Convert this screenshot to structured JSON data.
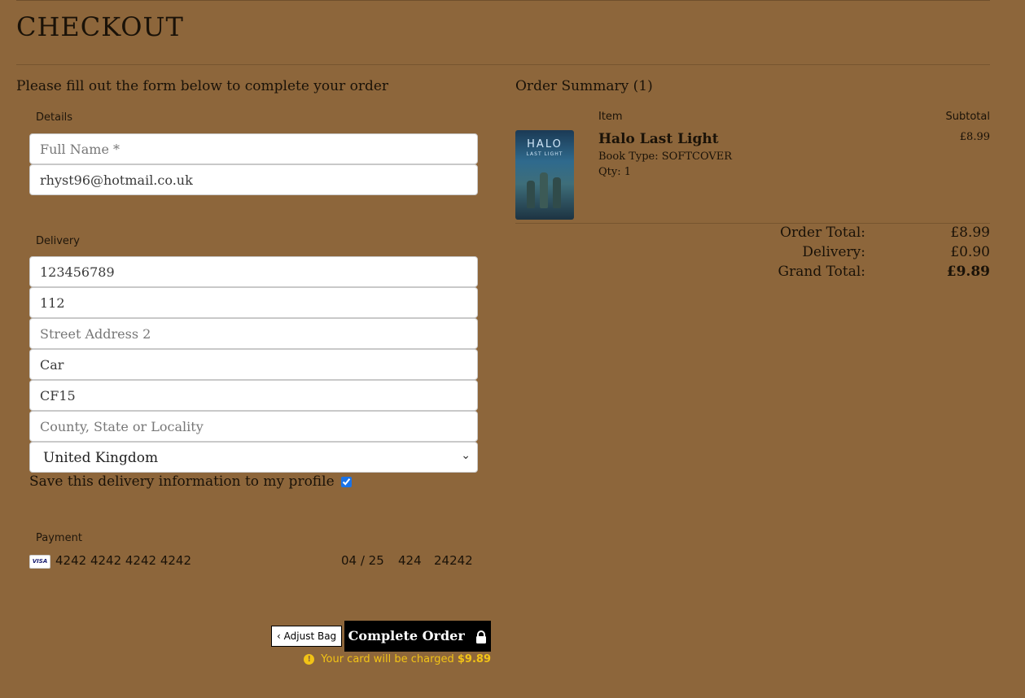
{
  "page": {
    "title": "CHECKOUT",
    "intro": "Please fill out the form below to complete your order"
  },
  "details": {
    "legend": "Details",
    "full_name_placeholder": "Full Name *",
    "email_value": "rhyst96@hotmail.co.uk"
  },
  "delivery": {
    "legend": "Delivery",
    "phone_value": "123456789",
    "street1_value": "112",
    "street2_placeholder": "Street Address 2",
    "town_value": "Car",
    "postcode_value": "CF15",
    "county_placeholder": "County, State or Locality",
    "country_selected": "United Kingdom",
    "save_label": "Save this delivery information to my profile",
    "save_checked": true
  },
  "payment": {
    "legend": "Payment",
    "card_icon": "visa-icon",
    "card_number": "4242 4242 4242 4242",
    "expiry": "04 / 25",
    "cvc": "424",
    "postal": "24242"
  },
  "actions": {
    "adjust_label": "Adjust Bag",
    "complete_label": "Complete Order",
    "charge_text": "Your card will be charged",
    "charge_amount": "$9.89"
  },
  "summary": {
    "title": "Order Summary (1)",
    "col_item": "Item",
    "col_subtotal": "Subtotal",
    "items": [
      {
        "name": "Halo Last Light",
        "type": "Book Type: SOFTCOVER",
        "qty": "Qty: 1",
        "price": "£8.99",
        "cover_title": "HALO",
        "cover_subtitle": "LAST LIGHT"
      }
    ],
    "order_total_label": "Order Total:",
    "order_total": "£8.99",
    "delivery_label": "Delivery:",
    "delivery": "£0.90",
    "grand_total_label": "Grand Total:",
    "grand_total": "£9.89"
  },
  "colors": {
    "background": "#8d663b",
    "warning": "#f2c316",
    "button": "#000000"
  }
}
